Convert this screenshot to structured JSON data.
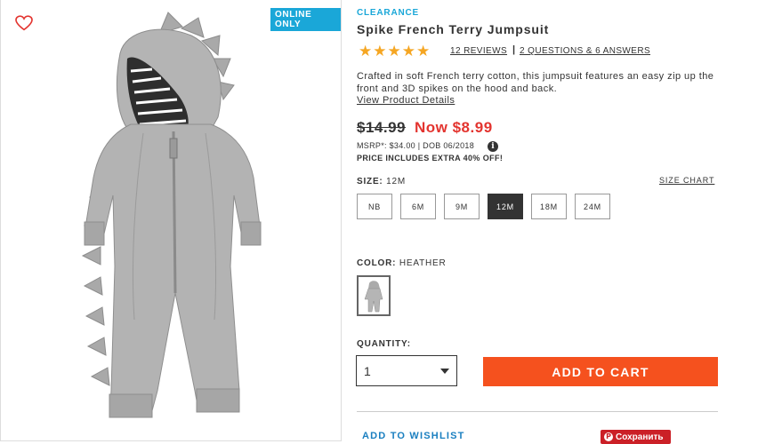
{
  "product_image": {
    "badge": "ONLINE ONLY",
    "alt": "gray dinosaur hooded zip jumpsuit",
    "wishlist_icon": "heart-outline-icon"
  },
  "product": {
    "category": "CLEARANCE",
    "title": "Spike French Terry Jumpsuit",
    "rating_stars": "★★★★★",
    "rating": 5,
    "reviews_link": "12 REVIEWS",
    "separator": "|",
    "qa_link": "2 QUESTIONS & 6 ANSWERS",
    "description": "Crafted in soft French terry cotton, this jumpsuit features an easy zip up the front and 3D spikes on the hood and back.",
    "details_link": "View Product Details"
  },
  "pricing": {
    "old_price": "$14.99",
    "now_price": "Now $8.99",
    "msrp_line": "MSRP*: $34.00 | DOB 06/2018",
    "info_icon": "i",
    "extra_offer": "PRICE INCLUDES EXTRA 40% OFF!"
  },
  "size": {
    "label": "SIZE:",
    "selected": "12M",
    "chart_link": "SIZE CHART",
    "options": [
      "NB",
      "6M",
      "9M",
      "12M",
      "18M",
      "24M"
    ]
  },
  "color": {
    "label": "COLOR:",
    "selected": "HEATHER"
  },
  "quantity": {
    "label": "QUANTITY:",
    "value": "1"
  },
  "actions": {
    "add_to_cart": "ADD TO CART",
    "add_to_wishlist": "ADD TO WISHLIST",
    "pinterest_icon": "P",
    "pinterest_label": "Сохранить"
  },
  "colors": {
    "accent_blue": "#1aa7d8",
    "sale_red": "#e3342f",
    "cart_orange": "#f5511e",
    "star_gold": "#f5a623",
    "pinterest_red": "#cb2027"
  }
}
